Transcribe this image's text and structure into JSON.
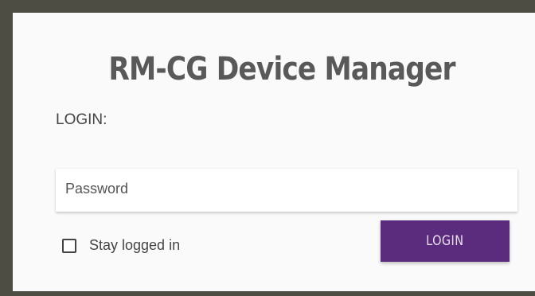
{
  "app": {
    "title": "RM-CG Device Manager"
  },
  "form": {
    "login_label": "LOGIN:",
    "password_placeholder": "Password",
    "password_value": "",
    "stay_logged_in_label": "Stay logged in",
    "stay_logged_in_checked": false,
    "submit_label": "LOGIN"
  },
  "colors": {
    "frame": "#4d4d44",
    "background": "#fafafa",
    "button": "#5b2c7d",
    "title_text": "#595959"
  }
}
